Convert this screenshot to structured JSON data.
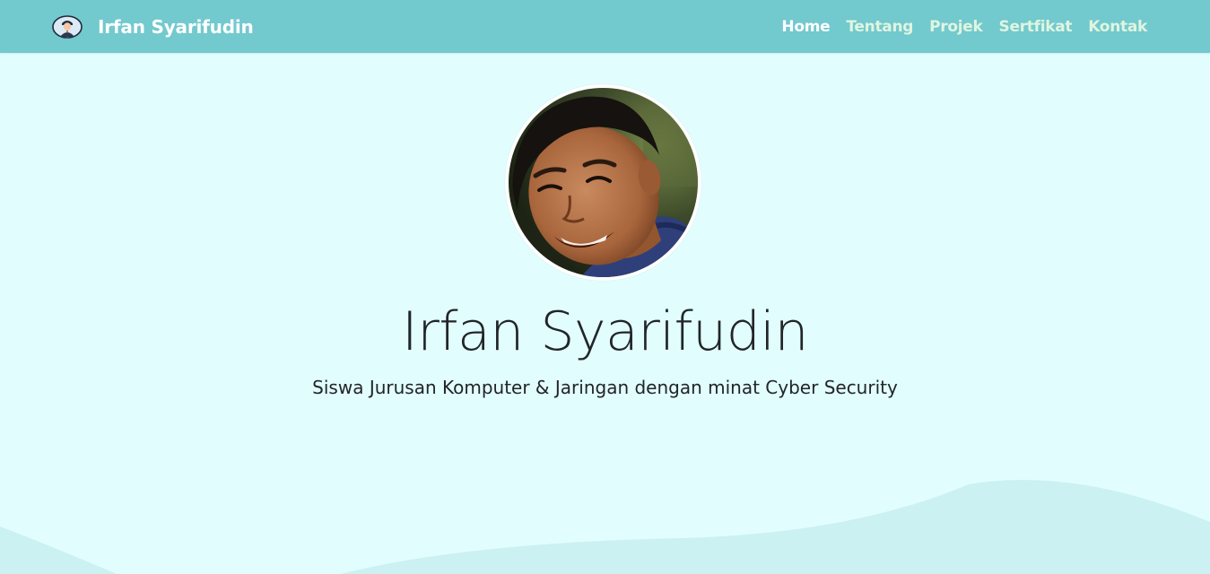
{
  "brand": {
    "name": "Irfan Syarifudin",
    "logo_icon": "avatar-logo-icon"
  },
  "nav": {
    "items": [
      {
        "label": "Home",
        "active": true
      },
      {
        "label": "Tentang",
        "active": false
      },
      {
        "label": "Projek",
        "active": false
      },
      {
        "label": "Sertfikat",
        "active": false
      },
      {
        "label": "Kontak",
        "active": false
      }
    ]
  },
  "hero": {
    "photo": "profile-photo",
    "title": "Irfan Syarifudin",
    "subtitle": "Siswa Jurusan Komputer & Jaringan dengan minat Cyber Security"
  },
  "colors": {
    "navbar": "#72c9ce",
    "background": "#e2fdfd",
    "wave": "#cbf1f2",
    "nav_active": "#ffffff",
    "nav_inactive": "#dff5e0"
  }
}
